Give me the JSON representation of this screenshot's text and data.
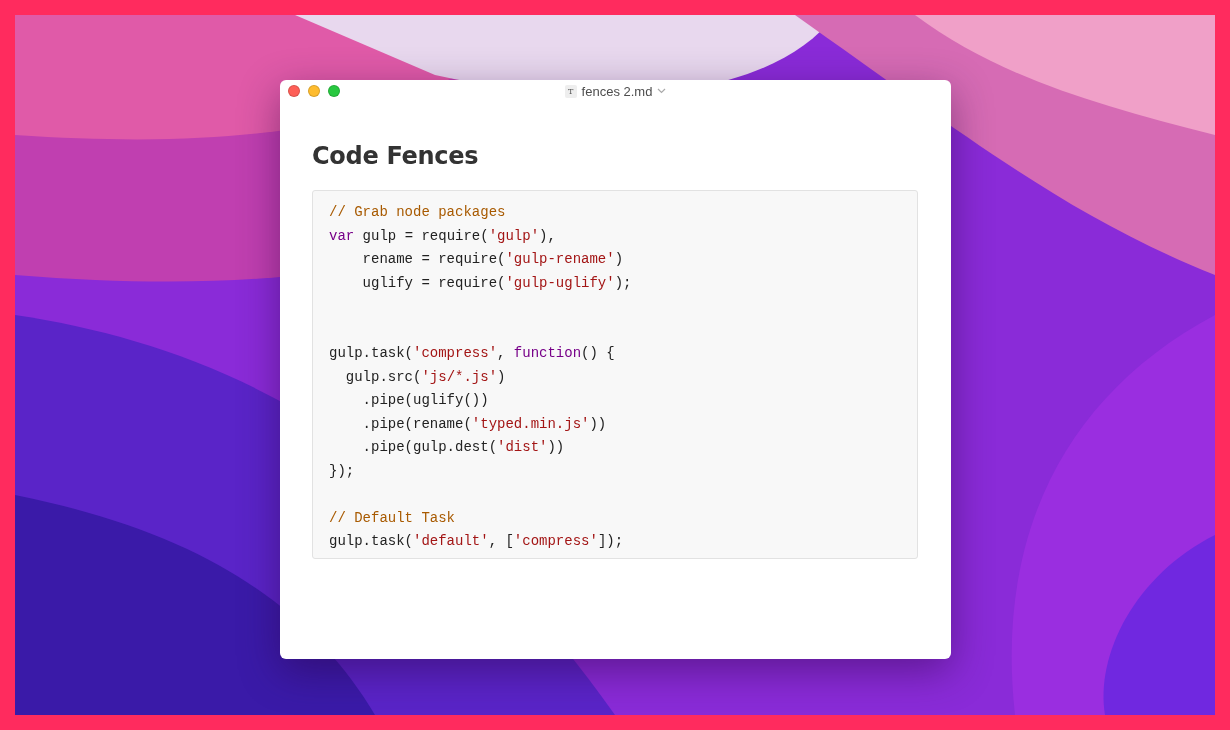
{
  "window": {
    "title": "fences 2.md",
    "file_badge": "T"
  },
  "document": {
    "heading": "Code Fences",
    "code_lines": [
      {
        "kind": "code",
        "tokens": [
          {
            "kind": "comment",
            "text": "// Grab node packages"
          }
        ]
      },
      {
        "kind": "code",
        "tokens": [
          {
            "kind": "keyword",
            "text": "var"
          },
          {
            "kind": "plain",
            "text": " gulp = require("
          },
          {
            "kind": "string",
            "text": "'gulp'"
          },
          {
            "kind": "plain",
            "text": "),"
          }
        ]
      },
      {
        "kind": "code",
        "tokens": [
          {
            "kind": "plain",
            "text": "    rename = require("
          },
          {
            "kind": "string",
            "text": "'gulp-rename'"
          },
          {
            "kind": "plain",
            "text": ")"
          }
        ]
      },
      {
        "kind": "code",
        "tokens": [
          {
            "kind": "plain",
            "text": "    uglify = require("
          },
          {
            "kind": "string",
            "text": "'gulp-uglify'"
          },
          {
            "kind": "plain",
            "text": ");"
          }
        ]
      },
      {
        "kind": "blank"
      },
      {
        "kind": "blank"
      },
      {
        "kind": "code",
        "tokens": [
          {
            "kind": "plain",
            "text": "gulp.task("
          },
          {
            "kind": "string",
            "text": "'compress'"
          },
          {
            "kind": "plain",
            "text": ", "
          },
          {
            "kind": "keyword",
            "text": "function"
          },
          {
            "kind": "plain",
            "text": "() {"
          }
        ]
      },
      {
        "kind": "code",
        "tokens": [
          {
            "kind": "plain",
            "text": "  gulp.src("
          },
          {
            "kind": "string",
            "text": "'js/*.js'"
          },
          {
            "kind": "plain",
            "text": ")"
          }
        ]
      },
      {
        "kind": "code",
        "tokens": [
          {
            "kind": "plain",
            "text": "    .pipe(uglify())"
          }
        ]
      },
      {
        "kind": "code",
        "tokens": [
          {
            "kind": "plain",
            "text": "    .pipe(rename("
          },
          {
            "kind": "string",
            "text": "'typed.min.js'"
          },
          {
            "kind": "plain",
            "text": "))"
          }
        ]
      },
      {
        "kind": "code",
        "tokens": [
          {
            "kind": "plain",
            "text": "    .pipe(gulp.dest("
          },
          {
            "kind": "string",
            "text": "'dist'"
          },
          {
            "kind": "plain",
            "text": "))"
          }
        ]
      },
      {
        "kind": "code",
        "tokens": [
          {
            "kind": "plain",
            "text": "});"
          }
        ]
      },
      {
        "kind": "blank"
      },
      {
        "kind": "code",
        "tokens": [
          {
            "kind": "comment",
            "text": "// Default Task"
          }
        ]
      },
      {
        "kind": "code",
        "tokens": [
          {
            "kind": "plain",
            "text": "gulp.task("
          },
          {
            "kind": "string",
            "text": "'default'"
          },
          {
            "kind": "plain",
            "text": ", ["
          },
          {
            "kind": "string",
            "text": "'compress'"
          },
          {
            "kind": "plain",
            "text": "]);"
          }
        ]
      }
    ]
  }
}
